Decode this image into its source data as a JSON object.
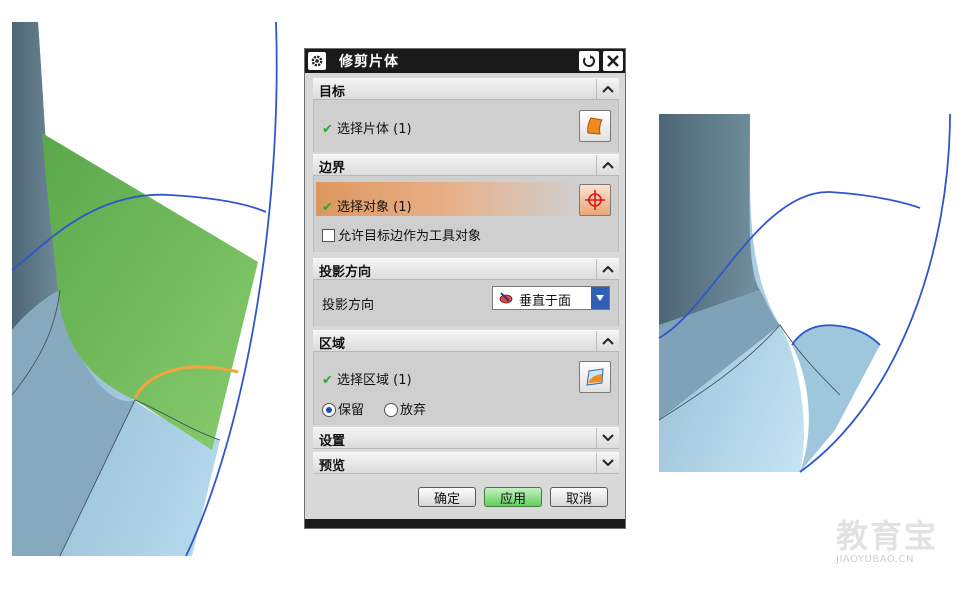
{
  "dialog": {
    "title": "修剪片体",
    "sections": {
      "target": {
        "header": "目标",
        "row_label": "选择片体 (1)"
      },
      "boundary": {
        "header": "边界",
        "row_label": "选择对象 (1)",
        "checkbox_label": "允许目标边作为工具对象",
        "checkbox_checked": false
      },
      "projection": {
        "header": "投影方向",
        "row_label": "投影方向",
        "dropdown_value": "垂直于面"
      },
      "region": {
        "header": "区域",
        "row_label": "选择区域 (1)",
        "radio_keep": "保留",
        "radio_discard": "放弃",
        "selected": "保留"
      },
      "settings": {
        "header": "设置"
      },
      "preview": {
        "header": "预览"
      }
    },
    "buttons": {
      "ok": "确定",
      "apply": "应用",
      "cancel": "取消"
    }
  },
  "watermark": {
    "main": "教育宝",
    "sub": "JIAOYUBAO.CN"
  },
  "colors": {
    "surface_grey": "#5b7484",
    "surface_light_blue": "#a9d2ea",
    "green_sheet": "#7bbf63",
    "curve_blue": "#2e58c9",
    "curve_orange": "#f2a440",
    "highlight_orange": "#dd9760",
    "apply_green": "#5fcf5a"
  }
}
